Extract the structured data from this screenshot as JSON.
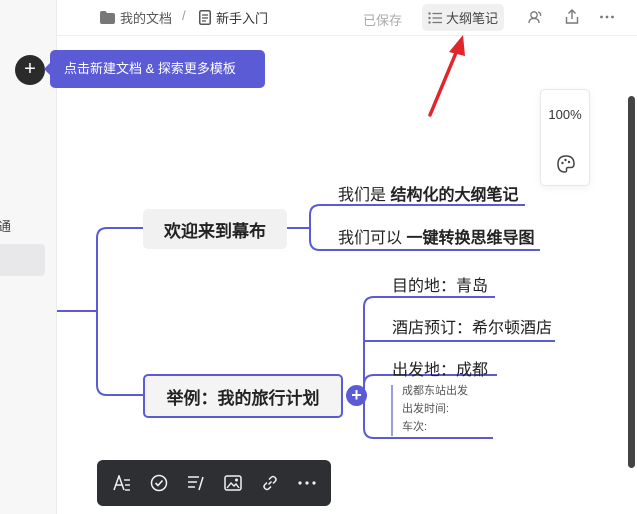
{
  "topbar": {
    "breadcrumb_folder": "我的文档",
    "breadcrumb_separator": "/",
    "breadcrumb_doc": "新手入门",
    "save_status": "已保存",
    "outline_button": "大纲笔记"
  },
  "sidebar": {
    "partial_text": "通"
  },
  "tip": {
    "text": "点击新建文档 & 探索更多模板"
  },
  "zoom": {
    "level": "100%"
  },
  "mindmap": {
    "node_welcome": "欢迎来到幕布",
    "welcome_child1_prefix": "我们是 ",
    "welcome_child1_bold": "结构化的大纲笔记",
    "welcome_child2_prefix": "我们可以 ",
    "welcome_child2_bold": "一键转换思维导图",
    "node_trip": "举例：我的旅行计划",
    "trip_destination": "目的地：青岛",
    "trip_hotel": "酒店预订：希尔顿酒店",
    "trip_departure": "出发地：成都",
    "note_line1": "成都东站出发",
    "note_line2": "出发时间:",
    "note_line3": "车次:"
  },
  "colors": {
    "accent": "#5b5bd6",
    "arrow": "#e0262b",
    "toolbar_bg": "#2d2f33"
  },
  "toolbar_icons": [
    "text-style-icon",
    "check-circle-icon",
    "list-icon",
    "image-icon",
    "link-icon",
    "more-icon"
  ]
}
